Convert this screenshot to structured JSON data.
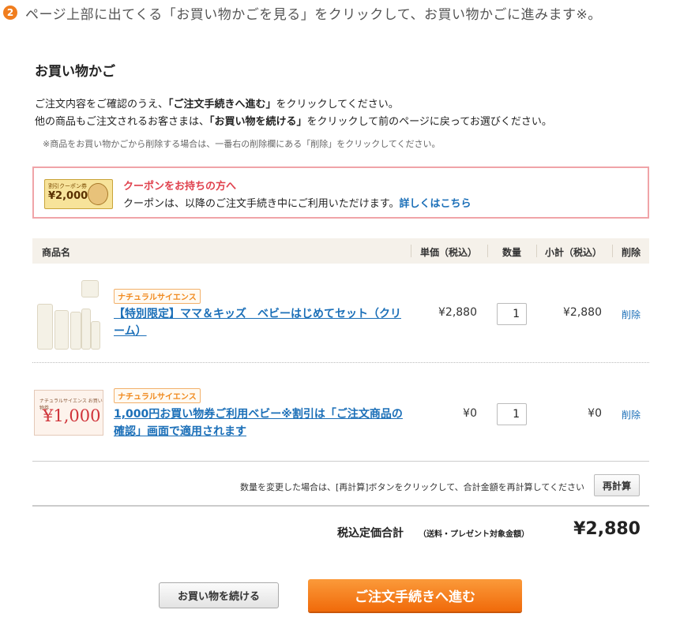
{
  "step": {
    "number": "2",
    "text": "ページ上部に出てくる「お買い物かごを見る」をクリックして、お買い物かごに進みます※。"
  },
  "cart": {
    "title": "お買い物かご",
    "intro_line1_before": "ご注文内容をご確認のうえ、",
    "intro_line1_bold": "「ご注文手続きへ進む」",
    "intro_line1_after": "をクリックしてください。",
    "intro_line2_before": "他の商品もご注文されるお客さまは、",
    "intro_line2_bold": "「お買い物を続ける」",
    "intro_line2_after": "をクリックして前のページに戻ってお選びください。",
    "note": "※商品をお買い物かごから削除する場合は、一番右の削除欄にある「削除」をクリックしてください。"
  },
  "coupon": {
    "image_label": "割引クーポン券",
    "image_amount": "¥2,000",
    "title": "クーポンをお持ちの方へ",
    "desc": "クーポンは、以降のご注文手続き中にご利用いただけます。",
    "link": "詳しくはこちら"
  },
  "table": {
    "headers": {
      "product": "商品名",
      "unit_price": "単価（税込）",
      "quantity": "数量",
      "subtotal": "小計（税込）",
      "delete": "削除"
    },
    "rows": [
      {
        "brand": "ナチュラルサイエンス",
        "name": "【特別限定】ママ＆キッズ　ベビーはじめてセット（クリーム）",
        "price": "¥2,880",
        "quantity": "1",
        "subtotal": "¥2,880",
        "delete": "削除"
      },
      {
        "brand": "ナチュラルサイエンス",
        "image_label": "ナチュラルサイエンス お買い物券",
        "image_amount": "¥1,000",
        "name": "1,000円お買い物券ご利用ベビー※割引は「ご注文商品の確認」画面で適用されます",
        "price": "¥0",
        "quantity": "1",
        "subtotal": "¥0",
        "delete": "削除"
      }
    ]
  },
  "recalc": {
    "note": "数量を変更した場合は、[再計算]ボタンをクリックして、合計金額を再計算してください",
    "button": "再計算"
  },
  "total": {
    "label": "税込定価合計",
    "sub": "（送料・プレゼント対象金額）",
    "value": "¥2,880"
  },
  "buttons": {
    "continue": "お買い物を続ける",
    "checkout": "ご注文手続きへ進む"
  },
  "colors": {
    "accent": "#f07d1e",
    "link": "#1b6fb8",
    "coupon_title": "#e0424e"
  }
}
